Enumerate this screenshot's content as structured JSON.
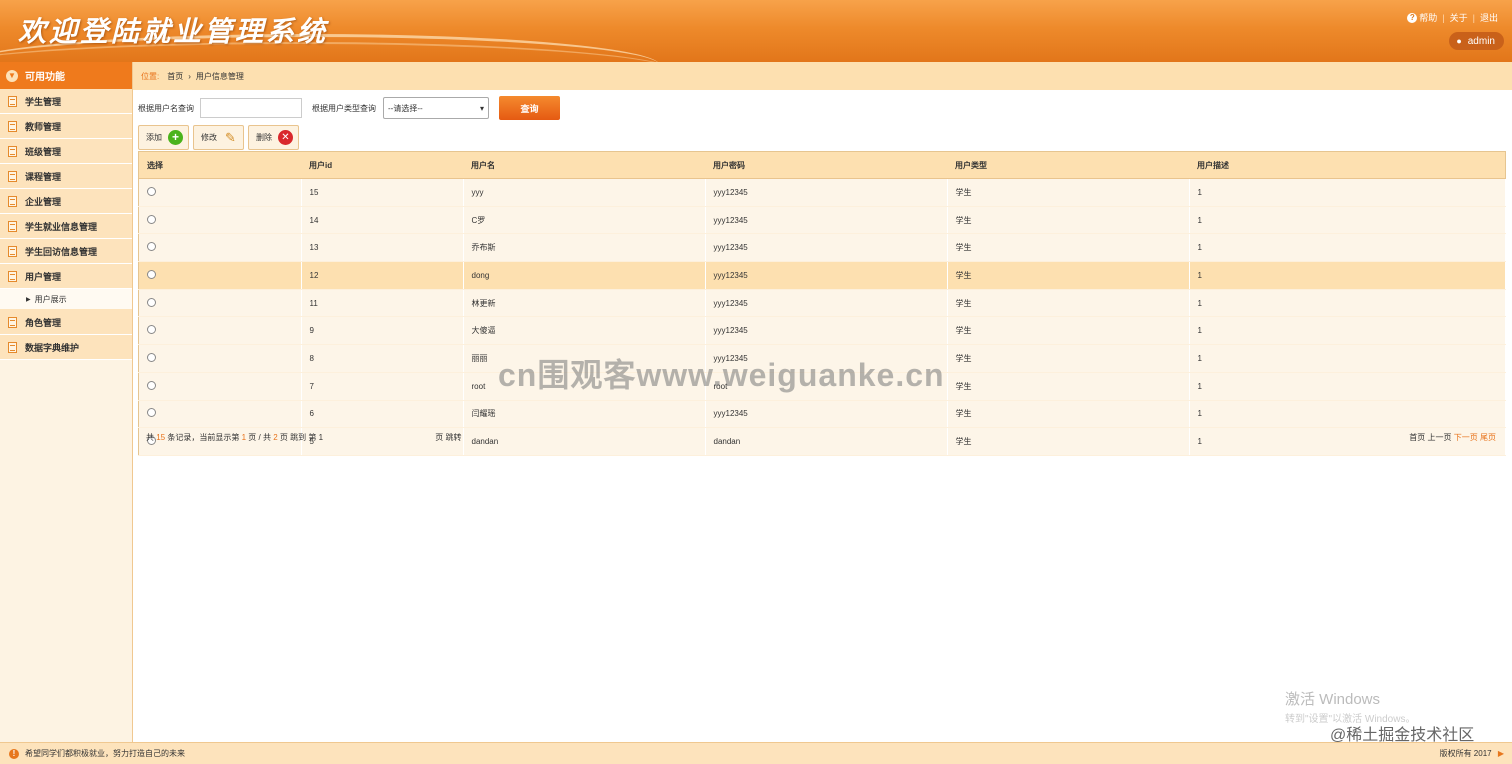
{
  "header": {
    "title": "欢迎登陆就业管理系统",
    "links": [
      "帮助",
      "关于",
      "退出"
    ],
    "user": "admin"
  },
  "sidebar": {
    "title": "可用功能",
    "items": [
      {
        "label": "学生管理"
      },
      {
        "label": "教师管理"
      },
      {
        "label": "班级管理"
      },
      {
        "label": "课程管理"
      },
      {
        "label": "企业管理"
      },
      {
        "label": "学生就业信息管理"
      },
      {
        "label": "学生回访信息管理"
      },
      {
        "label": "用户管理"
      }
    ],
    "sub_item": "用户展示",
    "items_after": [
      {
        "label": "角色管理"
      },
      {
        "label": "数据字典维护"
      }
    ]
  },
  "breadcrumb": {
    "location_label": "位置:",
    "items": [
      "首页",
      "用户信息管理"
    ]
  },
  "search": {
    "username_label": "根据用户名查询",
    "username_value": "",
    "usertype_label": "根据用户类型查询",
    "usertype_selected": "--请选择--",
    "query_button": "查询"
  },
  "toolbar": {
    "add": "添加",
    "edit": "修改",
    "delete": "删除"
  },
  "table": {
    "columns": [
      "选择",
      "用户id",
      "用户名",
      "用户密码",
      "用户类型",
      "用户描述"
    ],
    "rows": [
      [
        "15",
        "yyy",
        "yyy12345",
        "学生",
        "1"
      ],
      [
        "14",
        "C罗",
        "yyy12345",
        "学生",
        "1"
      ],
      [
        "13",
        "乔布斯",
        "yyy12345",
        "学生",
        "1"
      ],
      [
        "12",
        "dong",
        "yyy12345",
        "学生",
        "1"
      ],
      [
        "11",
        "林更新",
        "yyy12345",
        "学生",
        "1"
      ],
      [
        "9",
        "大傻逼",
        "yyy12345",
        "学生",
        "1"
      ],
      [
        "8",
        "丽丽",
        "yyy12345",
        "学生",
        "1"
      ],
      [
        "7",
        "root",
        "root",
        "学生",
        "1"
      ],
      [
        "6",
        "闫耀瑶",
        "yyy12345",
        "学生",
        "1"
      ],
      [
        "5",
        "dandan",
        "dandan",
        "学生",
        "1"
      ]
    ],
    "highlighted_row": 3
  },
  "pagination": {
    "total_prefix": "共",
    "total": "15",
    "total_suffix": "条记录，当前显示第",
    "current": "1",
    "page_of": "页 / 共",
    "pages": "2",
    "page_word": "页",
    "jump_label": "跳到 第 1",
    "jump_suffix": "页",
    "jump_button": "跳转",
    "first": "首页",
    "prev": "上一页",
    "next": "下一页",
    "last": "尾页"
  },
  "watermarks": {
    "center": "cn围观客www.weiguanke.cn",
    "windows_line1": "激活 Windows",
    "windows_line2": "转到\"设置\"以激活 Windows。",
    "juejin": "@稀土掘金技术社区"
  },
  "footer": {
    "message": "希望同学们都积极就业，努力打造自己的未来",
    "copyright": "版权所有 2017"
  },
  "colors": {
    "accent": "#e8731b",
    "header_bg": "#ee8a2b",
    "row_highlight": "#fde0b0"
  }
}
